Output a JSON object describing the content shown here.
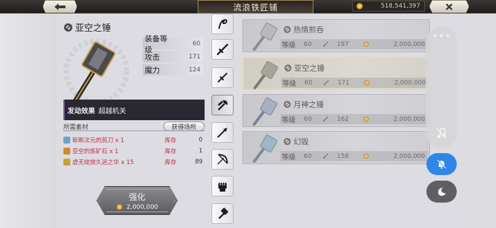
{
  "header": {
    "title": "流浪铁匠铺",
    "gold": "518,541,397",
    "back_icon": "arrow-left-icon",
    "close_icon": "close-x-icon"
  },
  "selected_item": {
    "name": "亚空之锤",
    "stats": [
      {
        "label": "装备等级",
        "value": "60"
      },
      {
        "label": "攻击",
        "value": "171"
      },
      {
        "label": "魔力",
        "value": "124"
      }
    ],
    "effect_label": "发动效果",
    "effect_value": "超越机关",
    "materials_header": "所需素材",
    "source_button": "获得场所",
    "materials": [
      {
        "name": "斩断次元的剪刀 x 1",
        "stock_label": "库存",
        "count": "0",
        "color": "#6aa3c7"
      },
      {
        "name": "亚空的炼矿石 x 1",
        "stock_label": "库存",
        "count": "1",
        "color": "#d18a2a"
      },
      {
        "name": "虚无绽放久远之华 x 15",
        "stock_label": "库存",
        "count": "89",
        "color": "#c7a02e"
      }
    ],
    "enhance_label": "强化",
    "enhance_cost": "2,000,000"
  },
  "tabs": [
    {
      "name": "tab-whip",
      "icon": "whip-icon"
    },
    {
      "name": "tab-sword",
      "icon": "sword-icon"
    },
    {
      "name": "tab-dagger",
      "icon": "dagger-icon"
    },
    {
      "name": "tab-axe",
      "icon": "axe-icon",
      "active": true
    },
    {
      "name": "tab-spear",
      "icon": "spear-icon"
    },
    {
      "name": "tab-bow",
      "icon": "bow-icon"
    },
    {
      "name": "tab-gauntlet",
      "icon": "gauntlet-icon"
    },
    {
      "name": "tab-hammer",
      "icon": "hammer-icon"
    }
  ],
  "items": [
    {
      "name": "热情煎吞",
      "level_label": "等级",
      "level": "60",
      "attack": "197",
      "price": "2,000,000",
      "selected": false
    },
    {
      "name": "亚空之锤",
      "level_label": "等级",
      "level": "60",
      "attack": "171",
      "price": "2,000,000",
      "selected": true
    },
    {
      "name": "月神之锤",
      "level_label": "等级",
      "level": "60",
      "attack": "162",
      "price": "2,000,000",
      "selected": false
    },
    {
      "name": "幻毁",
      "level_label": "等级",
      "level": "60",
      "attack": "158",
      "price": "2,000,000",
      "selected": false
    }
  ],
  "overlay": {
    "more_dots": "•••",
    "music_icon": "music-off-icon",
    "bell_icon": "bell-off-icon",
    "moon_icon": "moon-icon"
  },
  "colors": {
    "accent_blue": "#2f86e8",
    "stock_red": "#c0304a",
    "selected_border": "#e7d9a3"
  }
}
